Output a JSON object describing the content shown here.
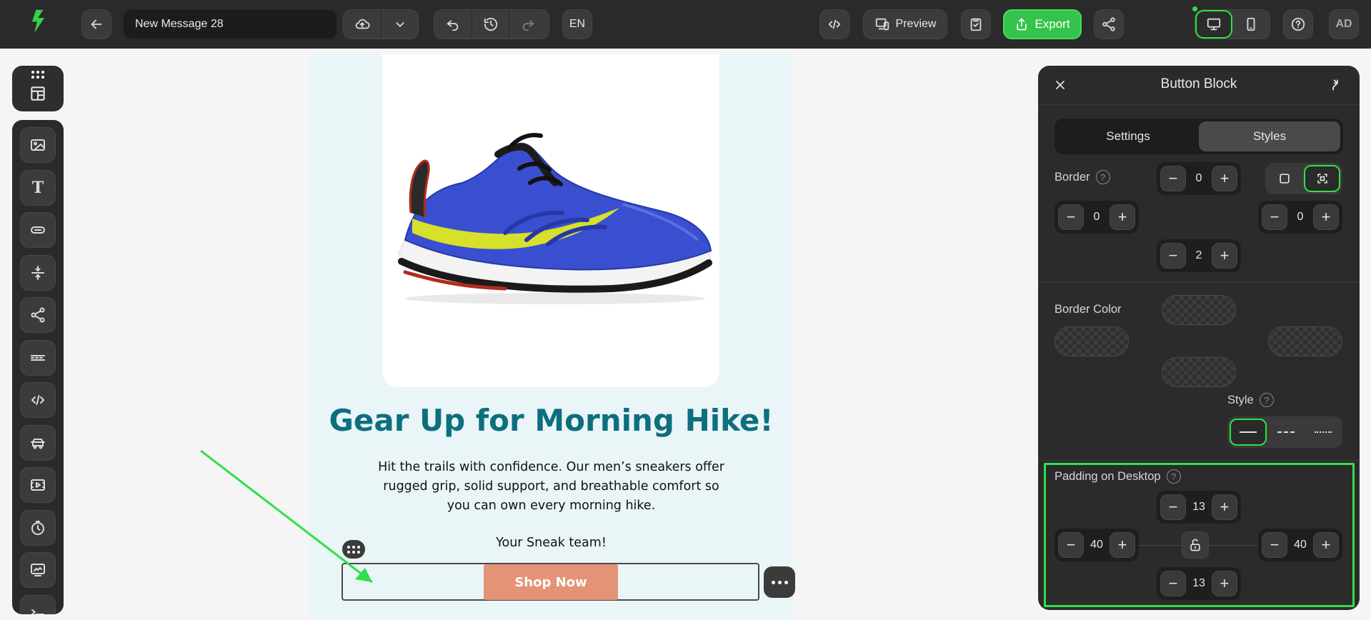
{
  "colors": {
    "accent": "#2fe04a",
    "email_bg": "#eaf5f7",
    "headline": "#0d6f7e",
    "cta": "#e49377",
    "export": "#36c34b"
  },
  "topbar": {
    "message_name": "New Message 28",
    "lang": "EN",
    "preview_label": "Preview",
    "export_label": "Export",
    "avatar_initials": "AD"
  },
  "email": {
    "headline": "Gear Up for Morning Hike!",
    "body": "Hit the trails with confidence. Our men’s sneakers offer rugged grip, solid support, and breathable comfort so you can own every morning hike.",
    "signoff": "Your Sneak team!",
    "cta_label": "Shop Now"
  },
  "panel": {
    "title": "Button Block",
    "tabs": [
      {
        "label": "Settings",
        "active": false
      },
      {
        "label": "Styles",
        "active": true
      }
    ],
    "border": {
      "label": "Border",
      "top": "0",
      "left": "0",
      "right": "0",
      "bottom": "2"
    },
    "border_color_label": "Border Color",
    "style_label": "Style",
    "style_options": [
      "solid",
      "dashed",
      "dotted"
    ],
    "padding": {
      "label": "Padding on Desktop",
      "top": "13",
      "left": "40",
      "right": "40",
      "bottom": "13"
    }
  }
}
